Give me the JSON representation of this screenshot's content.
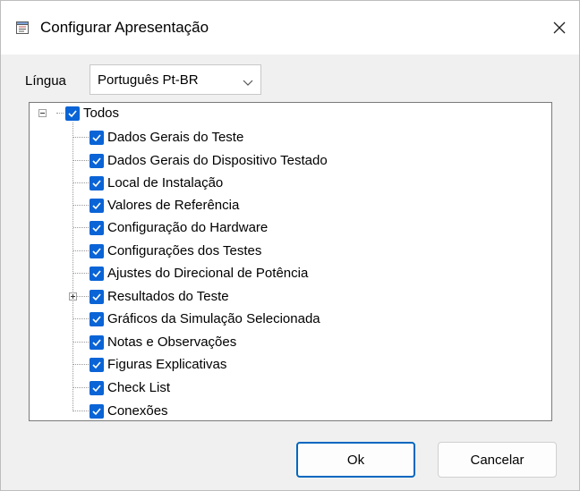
{
  "window": {
    "title": "Configurar Apresentação"
  },
  "language": {
    "label": "Língua",
    "selected": "Português Pt-BR"
  },
  "tree": {
    "root": {
      "label": "Todos",
      "checked": true,
      "expanded": true
    },
    "items": [
      {
        "label": "Dados Gerais do Teste",
        "checked": true
      },
      {
        "label": "Dados Gerais do Dispositivo Testado",
        "checked": true
      },
      {
        "label": "Local de Instalação",
        "checked": true
      },
      {
        "label": "Valores de Referência",
        "checked": true
      },
      {
        "label": "Configuração do Hardware",
        "checked": true
      },
      {
        "label": "Configurações dos Testes",
        "checked": true
      },
      {
        "label": "Ajustes do Direcional de Potência",
        "checked": true
      },
      {
        "label": "Resultados do Teste",
        "checked": true,
        "expandable": true
      },
      {
        "label": "Gráficos da Simulação Selecionada",
        "checked": true
      },
      {
        "label": "Notas e Observações",
        "checked": true
      },
      {
        "label": "Figuras Explicativas",
        "checked": true
      },
      {
        "label": "Check List",
        "checked": true
      },
      {
        "label": "Conexões",
        "checked": true
      }
    ]
  },
  "buttons": {
    "ok": "Ok",
    "cancel": "Cancelar"
  },
  "colors": {
    "checkbox": "#0a64d6",
    "primary_border": "#0067c0"
  }
}
